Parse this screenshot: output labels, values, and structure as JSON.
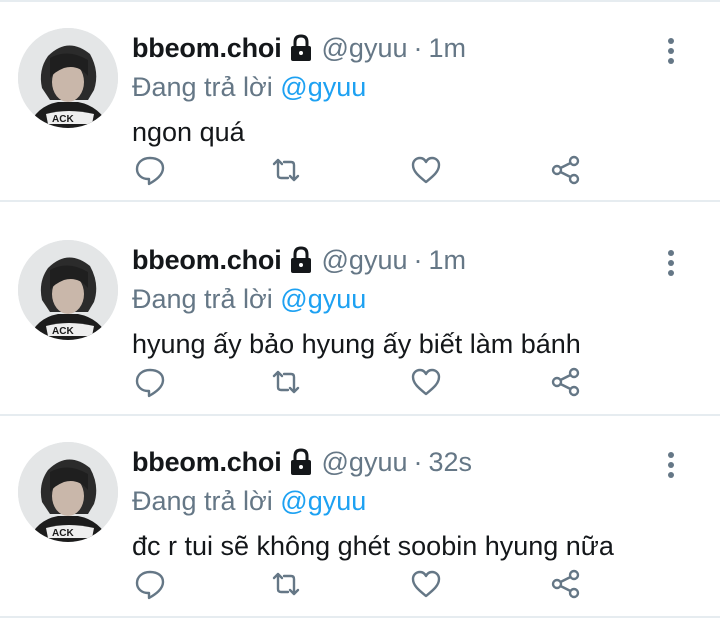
{
  "tweets": [
    {
      "display_name": "bbeom.choi",
      "handle": "@gyuu",
      "separator": "·",
      "time": "1m",
      "reply_prefix": "Đang trả lời",
      "reply_to": "@gyuu",
      "text": "ngon quá",
      "avatar_caption": "ACK"
    },
    {
      "display_name": "bbeom.choi",
      "handle": "@gyuu",
      "separator": "·",
      "time": "1m",
      "reply_prefix": "Đang trả lời",
      "reply_to": "@gyuu",
      "text": "hyung ấy bảo hyung ấy biết làm bánh",
      "avatar_caption": "ACK"
    },
    {
      "display_name": "bbeom.choi",
      "handle": "@gyuu",
      "separator": "·",
      "time": "32s",
      "reply_prefix": "Đang trả lời",
      "reply_to": "@gyuu",
      "text": "đc r tui sẽ không ghét soobin hyung nữa",
      "avatar_caption": "ACK"
    }
  ],
  "icons": {
    "lock": "lock-icon",
    "more": "more-vertical-icon",
    "reply": "reply-icon",
    "retweet": "retweet-icon",
    "like": "heart-icon",
    "share": "share-icon"
  },
  "colors": {
    "link": "#1da1f2",
    "secondary_text": "#657786",
    "primary_text": "#14171a",
    "divider": "#e6ecf0"
  }
}
